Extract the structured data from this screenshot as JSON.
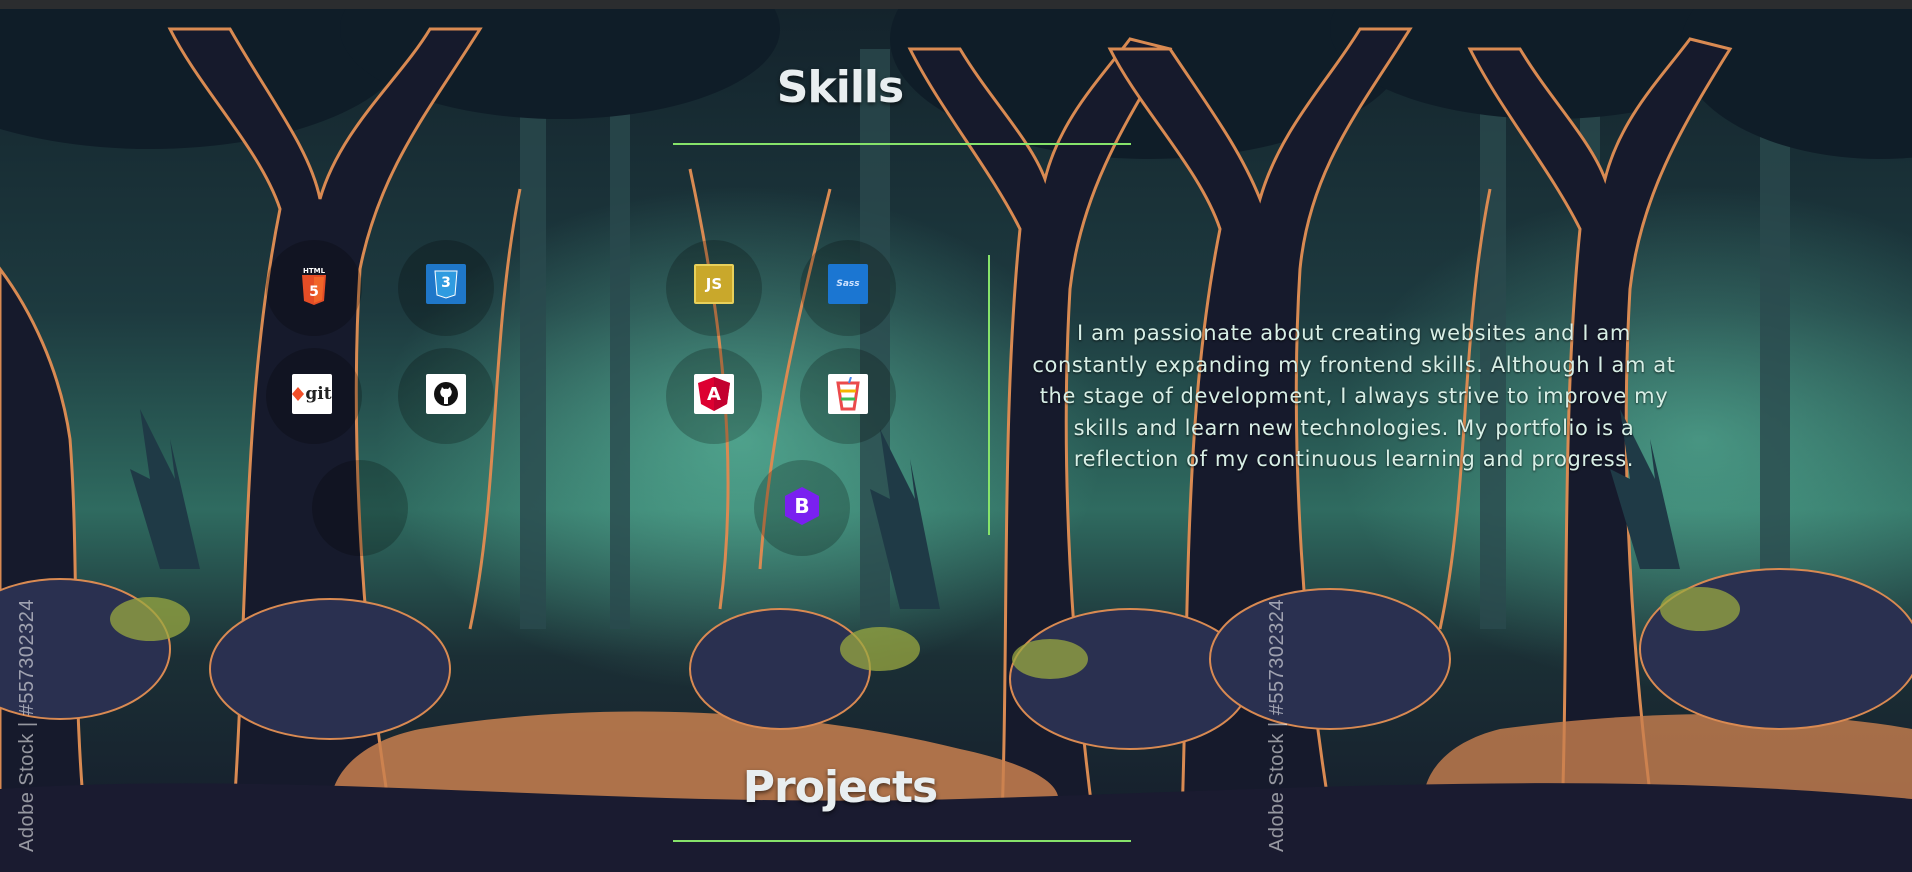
{
  "skills_section": {
    "title": "Skills",
    "icons": [
      {
        "name": "html5-icon",
        "label": "5",
        "caption": "HTML",
        "color": "#e44d26"
      },
      {
        "name": "css3-icon",
        "label": "3",
        "caption": "CSS",
        "color": "#1f77c9"
      },
      {
        "name": "javascript-icon",
        "label": "JS",
        "color": "#c9a82b"
      },
      {
        "name": "sass-icon",
        "label": "Sass",
        "color": "#1b76d2"
      },
      {
        "name": "git-icon",
        "label": "git",
        "color": "#f34f29"
      },
      {
        "name": "github-icon",
        "label": "",
        "color": "#111111"
      },
      {
        "name": "angular-icon",
        "label": "A",
        "color": "#dd0031"
      },
      {
        "name": "gulp-icon",
        "label": "",
        "color": "#eb4a4b"
      },
      {
        "name": "bootstrap-icon",
        "label": "B",
        "color": "#7a20f0"
      }
    ]
  },
  "about": {
    "text": "I am passionate about creating websites and I am constantly expanding my frontend skills. Although I am at the stage of development, I always strive to improve my skills and learn new technologies. My portfolio is a reflection of my continuous learning and progress."
  },
  "projects_section": {
    "title": "Projects"
  },
  "watermarks": {
    "left": "Adobe Stock | #557302324",
    "right": "Adobe Stock | #557302324"
  },
  "colors": {
    "accent_line": "#86e36a",
    "heading": "#e8eef0",
    "body_text": "#d8efe6"
  }
}
